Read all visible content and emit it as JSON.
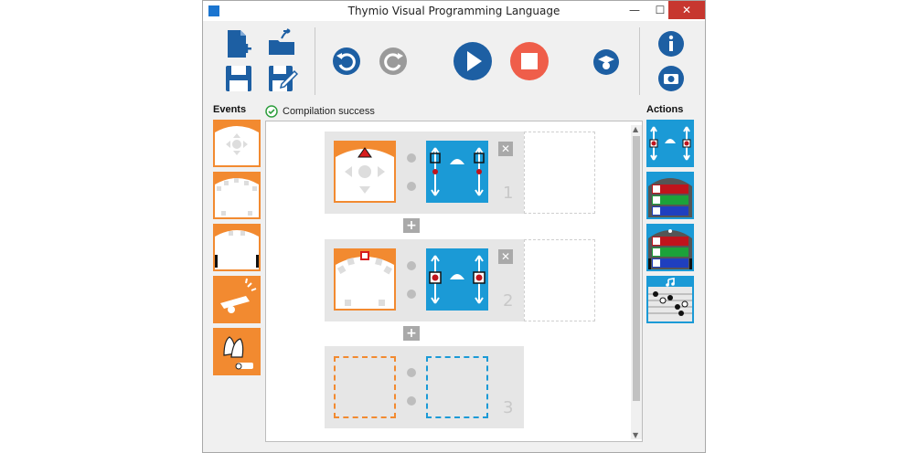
{
  "window": {
    "title": "Thymio Visual Programming Language",
    "minimize": "—",
    "maximize": "☐",
    "close": "✕"
  },
  "toolbar": {
    "icons": [
      "new-file-icon",
      "open-folder-icon",
      "save-icon",
      "save-as-icon",
      "undo-icon",
      "redo-icon",
      "run-icon",
      "stop-icon",
      "advanced-mode-icon",
      "info-icon",
      "screenshot-icon"
    ]
  },
  "panels": {
    "events_label": "Events",
    "actions_label": "Actions"
  },
  "status": {
    "text": "Compilation success"
  },
  "scene": {
    "rows": [
      {
        "number": "1"
      },
      {
        "number": "2"
      },
      {
        "number": "3"
      }
    ],
    "add_label": "+",
    "remove_label": "✕"
  },
  "colors": {
    "event_orange": "#f28a30",
    "action_blue": "#1b9ad6",
    "run_blue": "#1d5fa3",
    "stop_red": "#ef5e4a"
  }
}
